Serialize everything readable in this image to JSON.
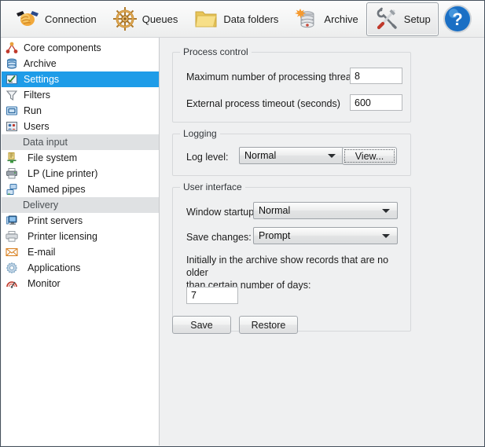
{
  "toolbar": {
    "items": [
      {
        "label": "Connection",
        "icon": "handshake-icon",
        "active": false
      },
      {
        "label": "Queues",
        "icon": "ships-wheel-icon",
        "active": false
      },
      {
        "label": "Data folders",
        "icon": "folder-icon",
        "active": false
      },
      {
        "label": "Archive",
        "icon": "database-icon",
        "active": false
      },
      {
        "label": "Setup",
        "icon": "tools-icon",
        "active": true
      }
    ],
    "help": {
      "label": "?",
      "icon": "help-icon"
    }
  },
  "sidebar": {
    "items": [
      {
        "label": "Core components",
        "icon": "nodes-icon",
        "type": "item",
        "selected": false
      },
      {
        "label": "Archive",
        "icon": "database-icon",
        "type": "item",
        "selected": false
      },
      {
        "label": "Settings",
        "icon": "checklist-icon",
        "type": "item",
        "selected": true
      },
      {
        "label": "Filters",
        "icon": "funnel-icon",
        "type": "item",
        "selected": false
      },
      {
        "label": "Run",
        "icon": "run-icon",
        "type": "item",
        "selected": false
      },
      {
        "label": "Users",
        "icon": "users-icon",
        "type": "item",
        "selected": false
      },
      {
        "label": "Data input",
        "icon": "",
        "type": "group",
        "selected": false
      },
      {
        "label": "File system",
        "icon": "file-system-icon",
        "type": "child",
        "selected": false
      },
      {
        "label": "LP (Line printer)",
        "icon": "line-printer-icon",
        "type": "child",
        "selected": false
      },
      {
        "label": "Named pipes",
        "icon": "named-pipes-icon",
        "type": "child",
        "selected": false
      },
      {
        "label": "Delivery",
        "icon": "",
        "type": "group",
        "selected": false
      },
      {
        "label": "Print servers",
        "icon": "print-server-icon",
        "type": "child",
        "selected": false
      },
      {
        "label": "Printer licensing",
        "icon": "printer-icon",
        "type": "child",
        "selected": false
      },
      {
        "label": "E-mail",
        "icon": "envelope-icon",
        "type": "child",
        "selected": false
      },
      {
        "label": "Applications",
        "icon": "gear-icon",
        "type": "child",
        "selected": false
      },
      {
        "label": "Monitor",
        "icon": "monitor-icon",
        "type": "child",
        "selected": false
      }
    ]
  },
  "main": {
    "process_control": {
      "title": "Process control",
      "threads_label": "Maximum number of processing threads:",
      "threads_value": "8",
      "timeout_label": "External process timeout (seconds)",
      "timeout_value": "600"
    },
    "logging": {
      "title": "Logging",
      "log_level_label": "Log level:",
      "log_level_value": "Normal",
      "view_button": "View..."
    },
    "user_interface": {
      "title": "User interface",
      "window_startup_label": "Window startup:",
      "window_startup_value": "Normal",
      "save_changes_label": "Save changes:",
      "save_changes_value": "Prompt",
      "archive_days_label_line1": "Initially in the archive show records that are no older",
      "archive_days_label_line2": "than certain number of days:",
      "archive_days_value": "7"
    },
    "actions": {
      "save_label": "Save",
      "restore_label": "Restore"
    }
  },
  "colors": {
    "selection_blue": "#1e9ce8",
    "group_header": "#dfe1e3",
    "panel_bg": "#eff0f1",
    "window_border": "#47525e"
  }
}
